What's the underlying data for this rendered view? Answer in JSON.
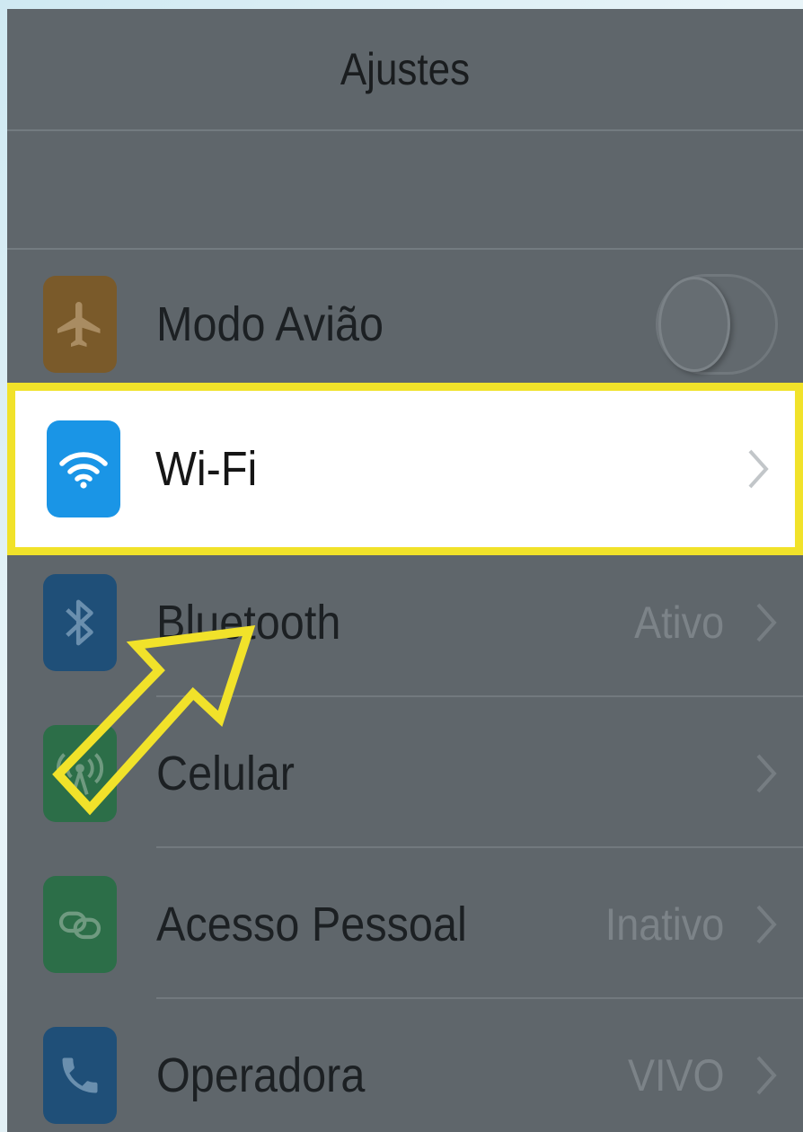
{
  "navbar": {
    "title": "Ajustes"
  },
  "settings": [
    {
      "label": "Modo Avião",
      "value": "",
      "icon": "airplane-icon",
      "icon_color": "#7a5a2a",
      "control": "toggle",
      "toggle_on": false
    },
    {
      "label": "Wi-Fi",
      "value": "",
      "icon": "wifi-icon",
      "icon_color": "#1a95e6",
      "control": "chevron",
      "highlighted": true
    },
    {
      "label": "Bluetooth",
      "value": "Ativo",
      "icon": "bluetooth-icon",
      "icon_color": "#1f4f78",
      "control": "chevron"
    },
    {
      "label": "Celular",
      "value": "",
      "icon": "cellular-icon",
      "icon_color": "#2c6e48",
      "control": "chevron"
    },
    {
      "label": "Acesso Pessoal",
      "value": "Inativo",
      "icon": "personal-hotspot-icon",
      "icon_color": "#2c6e48",
      "control": "chevron"
    },
    {
      "label": "Operadora",
      "value": "VIVO",
      "icon": "phone-icon",
      "icon_color": "#1f4f78",
      "control": "chevron"
    }
  ],
  "annotation": {
    "highlight_color": "#f1e22a",
    "arrow": "pointing-arrow-icon"
  }
}
